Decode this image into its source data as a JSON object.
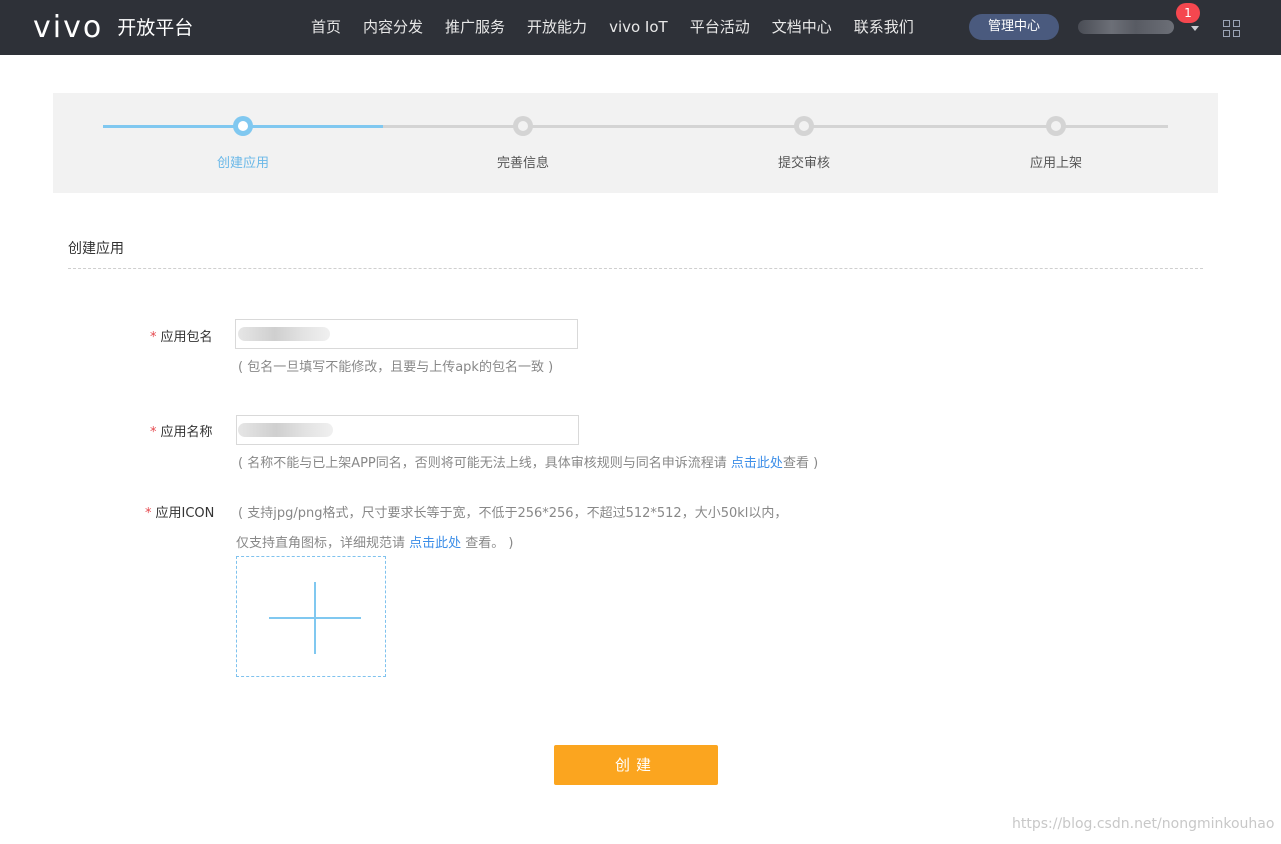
{
  "header": {
    "logo_text": "vivo",
    "logo_subtitle": "开放平台",
    "nav": [
      "首页",
      "内容分发",
      "推广服务",
      "开放能力",
      "vivo IoT",
      "平台活动",
      "文档中心",
      "联系我们"
    ],
    "management_button": "管理中心",
    "notification_count": "1"
  },
  "steps": {
    "items": [
      {
        "label": "创建应用",
        "active": true
      },
      {
        "label": "完善信息",
        "active": false
      },
      {
        "label": "提交审核",
        "active": false
      },
      {
        "label": "应用上架",
        "active": false
      }
    ],
    "progress_percent": 25
  },
  "form": {
    "section_title": "创建应用",
    "required_mark": "*",
    "package": {
      "label": "应用包名",
      "hint": "( 包名一旦填写不能修改，且要与上传apk的包名一致 )"
    },
    "app_name": {
      "label": "应用名称",
      "hint_before": "( 名称不能与已上架APP同名，否则将可能无法上线，具体审核规则与同名申诉流程请 ",
      "hint_link": "点击此处",
      "hint_after": "查看 )"
    },
    "icon": {
      "label": "应用ICON",
      "hint_line1": "( 支持jpg/png格式，尺寸要求长等于宽，不低于256*256，不超过512*512，大小50kl以内，",
      "hint_line2_before": "仅支持直角图标，详细规范请 ",
      "hint_line2_link": "点击此处",
      "hint_line2_after": " 查看。 )"
    },
    "submit_label": "创建"
  },
  "watermark": "https://blog.csdn.net/nongminkouhao",
  "colors": {
    "topbar": "#2e3138",
    "accent": "#80c8f0",
    "button": "#fba51f",
    "link": "#3c8ee8",
    "required": "#e5484d"
  }
}
